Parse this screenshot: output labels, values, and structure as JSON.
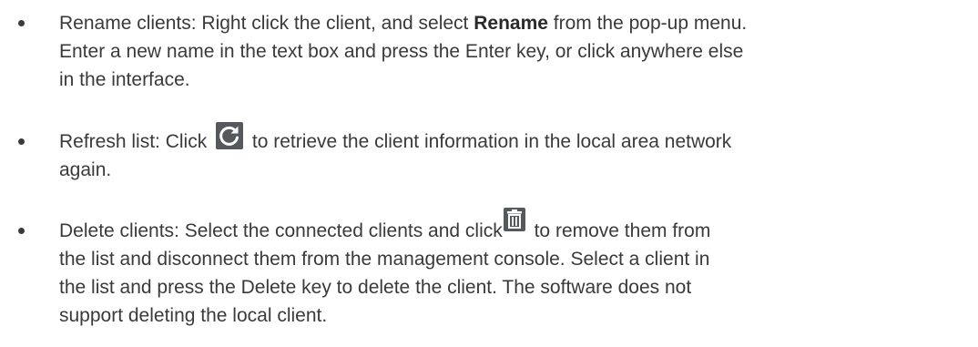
{
  "items": [
    {
      "lines": [
        {
          "before": "Rename clients: Right click the client, and select ",
          "bold": "Rename",
          "after": " from the pop-up menu."
        },
        {
          "text": "Enter a new name in the text box and press the Enter key, or click anywhere else"
        },
        {
          "text": "in the interface."
        }
      ]
    },
    {
      "icon": "refresh-icon",
      "lines": [
        {
          "before": "Refresh list: Click ",
          "after": " to retrieve the client information in the local area network"
        },
        {
          "text": "again."
        }
      ]
    },
    {
      "icon": "trash-icon",
      "lines": [
        {
          "before": "Delete clients: Select the connected clients and click",
          "after": " to remove them from"
        },
        {
          "text": "the list and disconnect them from the management console. Select a client in"
        },
        {
          "text": "the list and press the Delete key to delete the client. The software does not"
        },
        {
          "text": "support deleting the local client."
        }
      ]
    }
  ],
  "colors": {
    "text": "#3a3a3a",
    "icon_bg": "#55585c",
    "icon_fg": "#ffffff"
  }
}
